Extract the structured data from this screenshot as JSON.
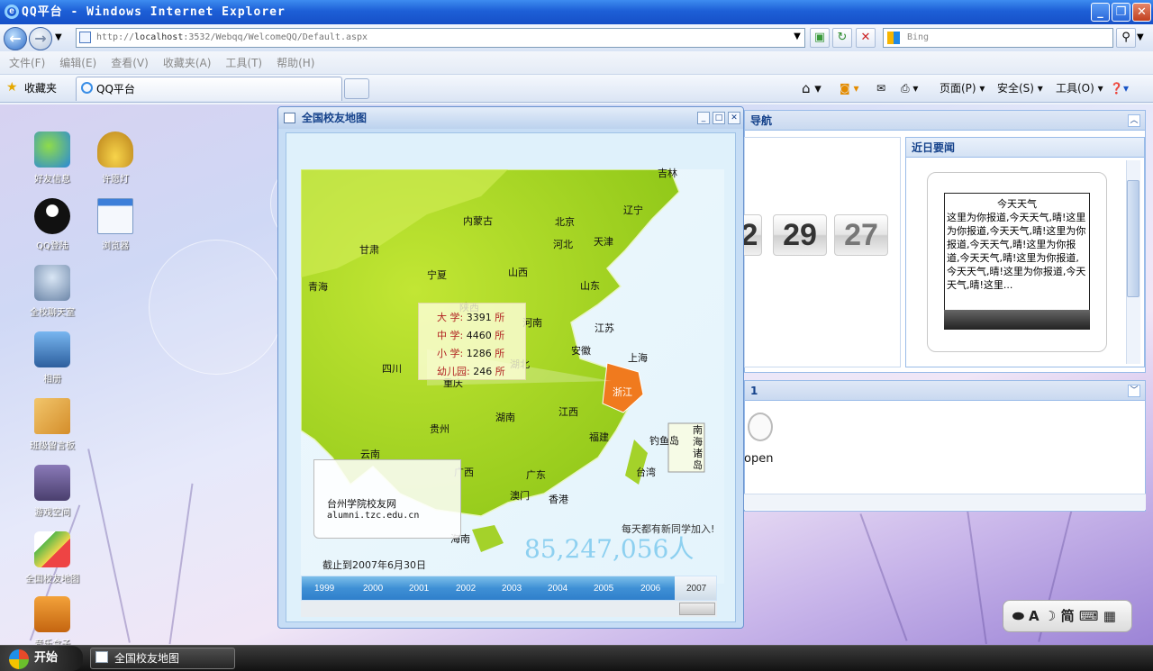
{
  "browser": {
    "title": "QQ平台 - Windows Internet Explorer",
    "url_prefix": "http://",
    "url_host": "localhost",
    "url_path": ":3532/Webqq/WelcomeQQ/Default.aspx",
    "search_placeholder": "Bing",
    "menu": [
      "文件(F)",
      "编辑(E)",
      "查看(V)",
      "收藏夹(A)",
      "工具(T)",
      "帮助(H)"
    ],
    "favorites_label": "收藏夹",
    "tab_title": "QQ平台",
    "toolbar": {
      "page": "页面(P)",
      "safety": "安全(S)",
      "tools": "工具(O)"
    }
  },
  "desktop_icons": [
    {
      "label": "好友信息",
      "icon": "msn-people-icon"
    },
    {
      "label": "许愿灯",
      "icon": "magic-lamp-icon"
    },
    {
      "label": "QQ登陆",
      "icon": "qq-penguin-icon"
    },
    {
      "label": "浏览器",
      "icon": "browser-window-icon"
    },
    {
      "label": "全校聊天室",
      "icon": "chatroom-people-icon"
    },
    {
      "label": "相册",
      "icon": "photo-album-icon"
    },
    {
      "label": "班级留言板",
      "icon": "folder-message-icon"
    },
    {
      "label": "游戏空间",
      "icon": "game-space-icon"
    },
    {
      "label": "全国校友地图",
      "icon": "map-280-icon"
    },
    {
      "label": "音乐盒子",
      "icon": "music-box-icon"
    }
  ],
  "right_panels": {
    "nav_title": "导航",
    "clock": {
      "a": "2",
      "b": "29",
      "c": "27"
    },
    "news_title": "近日要闻",
    "news_heading": "今天天气",
    "news_body": "这里为你报道,今天天气,晴!这里为你报道,今天天气,晴!这里为你报道,今天天气,晴!这里为你报道,今天天气,晴!这里为你报道,今天天气,晴!这里为你报道,今天天气,晴!这里...",
    "lower_title": "1",
    "open_label": "open"
  },
  "map_window": {
    "title": "全国校友地图",
    "provinces": [
      "吉林",
      "内蒙古",
      "北京",
      "辽宁",
      "天津",
      "河北",
      "甘肃",
      "宁夏",
      "山西",
      "山东",
      "青海",
      "陕西",
      "河南",
      "江苏",
      "四川",
      "湖北",
      "安徽",
      "上海",
      "重庆",
      "浙江",
      "贵州",
      "湖南",
      "江西",
      "福建",
      "钓鱼岛",
      "南海诸岛",
      "台湾",
      "云南",
      "广西",
      "广东",
      "澳门",
      "香港",
      "海南"
    ],
    "tooltip": [
      {
        "label": "大  学:",
        "value": "3391",
        "unit": "所"
      },
      {
        "label": "中  学:",
        "value": "4460",
        "unit": "所"
      },
      {
        "label": "小  学:",
        "value": "1286",
        "unit": "所"
      },
      {
        "label": "幼儿园:",
        "value": "246",
        "unit": "所"
      }
    ],
    "site_name": "台州学院校友网",
    "site_url": "alumni.tzc.edu.cn",
    "slogan": "每天都有新同学加入!",
    "counter": "85,247,056人",
    "as_of": "截止到2007年6月30日",
    "years": [
      "1999",
      "2000",
      "2001",
      "2002",
      "2003",
      "2004",
      "2005",
      "2006",
      "2007"
    ]
  },
  "taskbar": {
    "start": "开始",
    "task": "全国校友地图"
  },
  "langbar": {
    "items": [
      "A",
      "简"
    ]
  }
}
